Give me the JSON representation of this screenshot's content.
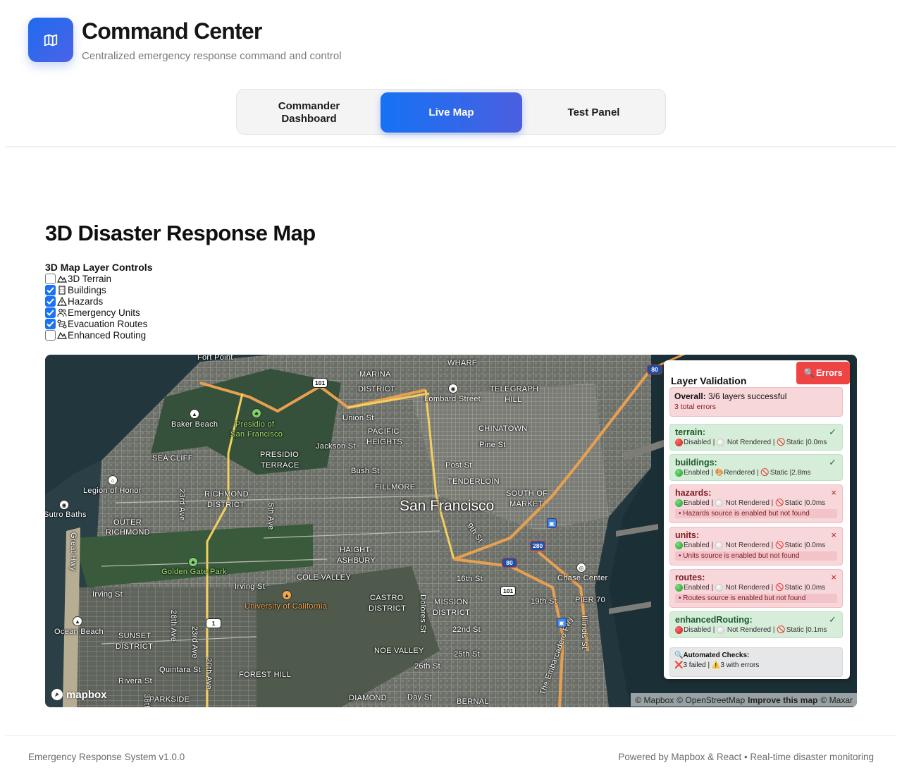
{
  "app": {
    "title": "Command Center",
    "subtitle": "Centralized emergency response command and control",
    "logo_icon": "map-icon",
    "accent_color": "#1f6bf0"
  },
  "tabs": [
    {
      "label_line1": "Commander",
      "label_line2": "Dashboard",
      "active": false
    },
    {
      "label": "Live Map",
      "active": true
    },
    {
      "label": "Test Panel",
      "active": false
    }
  ],
  "main": {
    "title": "3D Disaster Response Map",
    "controls_title": "3D Map Layer Controls",
    "layers": [
      {
        "label": "3D Terrain",
        "checked": false,
        "icon": "mountain-icon"
      },
      {
        "label": "Buildings",
        "checked": true,
        "icon": "building-icon"
      },
      {
        "label": "Hazards",
        "checked": true,
        "icon": "warning-icon"
      },
      {
        "label": "Emergency Units",
        "checked": true,
        "icon": "people-icon"
      },
      {
        "label": "Evacuation Routes",
        "checked": true,
        "icon": "route-icon"
      },
      {
        "label": "Enhanced Routing",
        "checked": false,
        "icon": "mountain-icon"
      }
    ]
  },
  "map": {
    "city_label": "San Francisco",
    "labels": {
      "fort_point": "Fort Point",
      "marina": "MARINA",
      "district": "DISTRICT",
      "wharf": "WHARF",
      "telegraph": "TELEGRAPH",
      "hill": "HILL",
      "lombard": "Lombard Street",
      "baker_beach": "Baker Beach",
      "presidio1": "Presidio of",
      "presidio2": "San Francisco",
      "union_st": "Union St",
      "pacific": "PACIFIC",
      "heights": "HEIGHTS",
      "chinatown": "CHINATOWN",
      "pine_st": "Pine St",
      "sea_cliff": "SEA CLIFF",
      "presidio_terrace1": "PRESIDIO",
      "presidio_terrace2": "TERRACE",
      "jackson_st": "Jackson St",
      "post_st": "Post St",
      "bush_st": "Bush St",
      "tenderloin": "TENDERLOIN",
      "legion": "Legion of Honor",
      "fillmore": "FILLMORE",
      "south_of": "SOUTH OF",
      "market": "MARKET",
      "richmond1": "RICHMOND",
      "richmond2": "DISTRICT",
      "23rd": "23rd Ave",
      "5th": "5th Ave",
      "sutro": "Sutro Baths",
      "outer1": "OUTER",
      "outer2": "RICHMOND",
      "haight1": "HAIGHT-",
      "haight2": "ASHBURY",
      "9th_st": "9th St",
      "great_hwy": "Great Hwy",
      "golden_gate": "Golden Gate Park",
      "cole_valley": "COLE VALLEY",
      "16th_st": "16th St",
      "chase": "Chase Center",
      "irving1": "Irving St",
      "irving2": "Irving St",
      "ucsf": "University of California",
      "castro1": "CASTRO",
      "castro2": "DISTRICT",
      "mission1": "MISSION",
      "mission2": "DISTRICT",
      "dolores": "Dolores St",
      "19th_st": "19th St",
      "pier70": "PIER 70",
      "illinois": "Illinois St",
      "ocean_beach": "Ocean Beach",
      "sunset1": "SUNSET",
      "sunset2": "DISTRICT",
      "28th": "28th Ave",
      "23rd2": "23rd Ave",
      "20th": "20th Ave",
      "22nd_st": "22nd St",
      "noe": "NOE VALLEY",
      "25th_st": "25th St",
      "26th_st": "26th St",
      "quintara": "Quintara St",
      "rivera": "Rivera St",
      "parkside": "PARKSIDE",
      "forest_hill": "FOREST HILL",
      "diamond": "DIAMOND",
      "day_st": "Day St",
      "bernal": "BERNAL",
      "embarcadero": "The Embarcadero Fwy",
      "38th": "38th"
    },
    "shields": {
      "us101a": "101",
      "us101b": "101",
      "i80a": "80",
      "i80b": "80",
      "i280": "280",
      "ca1": "1"
    },
    "brand": "mapbox",
    "attribution": {
      "mapbox": "© Mapbox",
      "osm": "© OpenStreetMap",
      "improve": "Improve this map",
      "maxar": "© Maxar"
    }
  },
  "validation": {
    "title": "Layer Validation",
    "errors_button": "Errors",
    "overall_label": "Overall:",
    "overall_value": "3/6 layers successful",
    "overall_errors": "3 total errors",
    "layers": [
      {
        "name": "terrain:",
        "ok": true,
        "mark": "✓",
        "state": "Disabled",
        "render": "Not Rendered",
        "mode": "Static",
        "time": "0.0ms",
        "state_dot": "red",
        "render_icon": "white-circle-icon",
        "error": ""
      },
      {
        "name": "buildings:",
        "ok": true,
        "mark": "✓",
        "state": "Enabled",
        "render": "Rendered",
        "mode": "Static",
        "time": "2.8ms",
        "state_dot": "green",
        "render_icon": "paint-icon",
        "error": ""
      },
      {
        "name": "hazards:",
        "ok": false,
        "mark": "×",
        "state": "Enabled",
        "render": "Not Rendered",
        "mode": "Static",
        "time": "0.0ms",
        "state_dot": "green",
        "render_icon": "white-circle-icon",
        "error": "• Hazards source is enabled but not found"
      },
      {
        "name": "units:",
        "ok": false,
        "mark": "×",
        "state": "Enabled",
        "render": "Not Rendered",
        "mode": "Static",
        "time": "0.0ms",
        "state_dot": "green",
        "render_icon": "white-circle-icon",
        "error": "• Units source is enabled but not found"
      },
      {
        "name": "routes:",
        "ok": false,
        "mark": "×",
        "state": "Enabled",
        "render": "Not Rendered",
        "mode": "Static",
        "time": "0.0ms",
        "state_dot": "green",
        "render_icon": "white-circle-icon",
        "error": "• Routes source is enabled but not found"
      },
      {
        "name": "enhancedRouting:",
        "ok": true,
        "mark": "✓",
        "state": "Disabled",
        "render": "Not Rendered",
        "mode": "Static",
        "time": "0.1ms",
        "state_dot": "red",
        "render_icon": "white-circle-icon",
        "error": ""
      }
    ],
    "auto_title": "Automated Checks:",
    "auto_failed": "3 failed",
    "auto_errors": "3 with errors",
    "colors": {
      "ok_bg": "#d6edd9",
      "bad_bg": "#f7d7da",
      "error_button": "#ef4444"
    }
  },
  "footer": {
    "left": "Emergency Response System v1.0.0",
    "right": "Powered by Mapbox & React • Real-time disaster monitoring"
  }
}
